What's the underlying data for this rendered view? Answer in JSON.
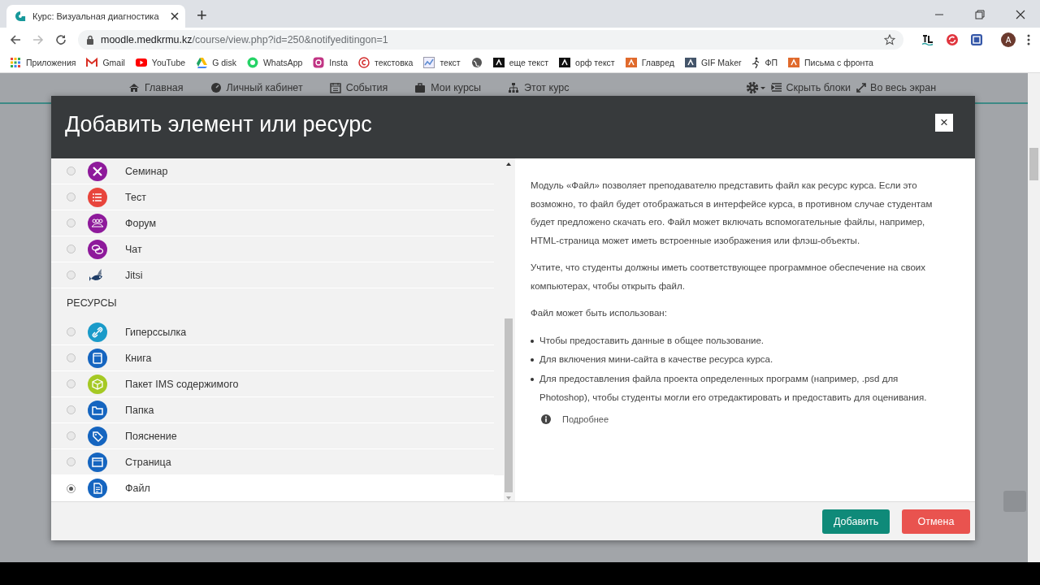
{
  "browser": {
    "tab_title": "Курс: Визуальная диагностика",
    "new_tab": "+",
    "url_host": "moodle.medkrmu.kz",
    "url_path": "/course/view.php?id=250&notifyeditingon=1",
    "profile_initial": "A"
  },
  "bookmarks": [
    {
      "label": "Приложения",
      "kind": "apps"
    },
    {
      "label": "Gmail",
      "kind": "mail"
    },
    {
      "label": "YouTube",
      "kind": "play"
    },
    {
      "label": "G disk",
      "kind": "drive"
    },
    {
      "label": "WhatsApp",
      "kind": "circle"
    },
    {
      "label": "Insta",
      "kind": "camera"
    },
    {
      "label": "текстовка",
      "kind": "copyright"
    },
    {
      "label": "текст",
      "kind": "chart"
    },
    {
      "kind": "globe"
    },
    {
      "label": "еще текст",
      "kind": "dark"
    },
    {
      "label": "орф текст",
      "kind": "dark"
    },
    {
      "label": "Главред",
      "kind": "orange"
    },
    {
      "label": "GIF Maker",
      "kind": "slate"
    },
    {
      "label": "ФП",
      "kind": "figure"
    },
    {
      "label": "Письма с фронта",
      "kind": "orange"
    }
  ],
  "nav": {
    "items": [
      {
        "label": "Главная",
        "kind": "home"
      },
      {
        "label": "Личный кабинет",
        "kind": "gauge"
      },
      {
        "label": "События",
        "kind": "calendar"
      },
      {
        "label": "Мои курсы",
        "kind": "briefcase"
      },
      {
        "label": "Этот курс",
        "kind": "sitemap"
      }
    ],
    "actions": [
      {
        "label": "Скрыть блоки",
        "kind": "indent"
      },
      {
        "label": "Во весь экран",
        "kind": "expand"
      }
    ]
  },
  "modal": {
    "title": "Добавить элемент или ресурс",
    "close": "×",
    "groups": [
      {
        "items": [
          {
            "label": "Семинар",
            "kind": "tools",
            "color": "#8e1a9b",
            "selected": false
          },
          {
            "label": "Тест",
            "kind": "list",
            "color": "#e8453c",
            "selected": false
          },
          {
            "label": "Форум",
            "kind": "people",
            "color": "#8e1a9b",
            "selected": false
          },
          {
            "label": "Чат",
            "kind": "chat",
            "color": "#8e1a9b",
            "selected": false
          },
          {
            "label": "Jitsi",
            "kind": "jitsi",
            "selected": false
          }
        ]
      },
      {
        "heading": "РЕСУРСЫ",
        "items": [
          {
            "label": "Гиперссылка",
            "kind": "link",
            "color": "#1a9bc9",
            "selected": false
          },
          {
            "label": "Книга",
            "kind": "book",
            "color": "#1565c0",
            "selected": false
          },
          {
            "label": "Пакет IMS содержимого",
            "kind": "package",
            "color": "#a5c924",
            "selected": false
          },
          {
            "label": "Папка",
            "kind": "folder",
            "color": "#1565c0",
            "selected": false
          },
          {
            "label": "Пояснение",
            "kind": "tag",
            "color": "#1565c0",
            "selected": false
          },
          {
            "label": "Страница",
            "kind": "page",
            "color": "#1565c0",
            "selected": false
          },
          {
            "label": "Файл",
            "kind": "file",
            "color": "#1565c0",
            "selected": true
          }
        ]
      }
    ],
    "description": {
      "paragraphs": [
        "Модуль «Файл» позволяет преподавателю представить файл как ресурс курса. Если это возможно, то файл будет отображаться в интерфейсе курса, в противном случае студентам будет предложено скачать его. Файл может включать вспомогательные файлы, например, HTML-страница может иметь встроенные изображения или флэш-объекты.",
        "Учтите, что студенты должны иметь соответствующее программное обеспечение на своих компьютерах, чтобы открыть файл.",
        "Файл может быть использован:"
      ],
      "bullets": [
        "Чтобы предоставить данные в общее пользование.",
        "Для включения мини-сайта в качестве ресурса курса.",
        "Для предоставления файла проекта определенных программ (например, .psd для Photoshop), чтобы студенты могли его отредактировать и предоставить для оценивания."
      ],
      "more_link": "Подробнее"
    },
    "buttons": [
      {
        "label": "Добавить",
        "kind": "primary"
      },
      {
        "label": "Отмена",
        "kind": "danger"
      }
    ]
  }
}
